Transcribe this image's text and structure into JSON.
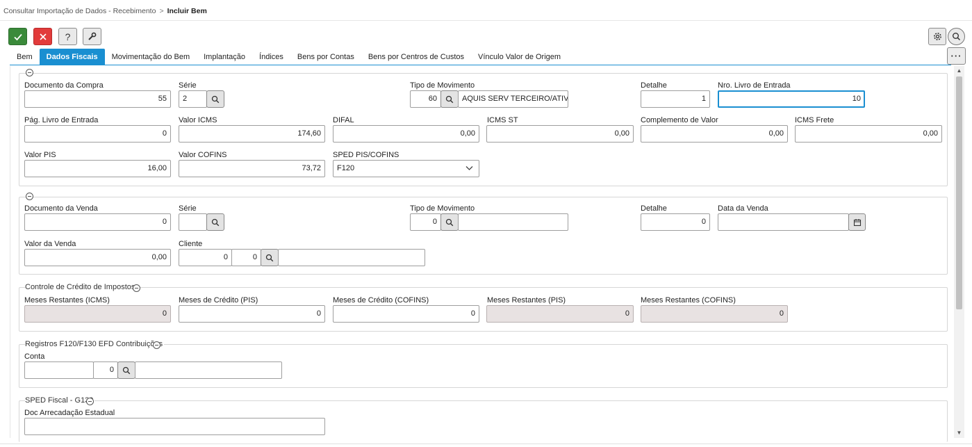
{
  "breadcrumb": {
    "parent": "Consultar Importação de Dados - Recebimento",
    "separator": ">",
    "current": "Incluir Bem"
  },
  "toolbar": {
    "help_label": "?",
    "more_label": "···"
  },
  "tabs": [
    "Bem",
    "Dados Fiscais",
    "Movimentação do Bem",
    "Implantação",
    "Índices",
    "Bens por Contas",
    "Bens por Centros de Custos",
    "Vínculo Valor de Origem"
  ],
  "active_tab": "Dados Fiscais",
  "compra": {
    "documento_label": "Documento da Compra",
    "documento_value": "55",
    "serie_label": "Série",
    "serie_value": "2",
    "tipo_mov_label": "Tipo de Movimento",
    "tipo_mov_code": "60",
    "tipo_mov_desc": "AQUIS SERV TERCEIRO/ATIVO",
    "detalhe_label": "Detalhe",
    "detalhe_value": "1",
    "nro_livro_label": "Nro. Livro de Entrada",
    "nro_livro_value": "10",
    "pag_livro_label": "Pág. Livro de Entrada",
    "pag_livro_value": "0",
    "valor_icms_label": "Valor ICMS",
    "valor_icms_value": "174,60",
    "difal_label": "DIFAL",
    "difal_value": "0,00",
    "icms_st_label": "ICMS ST",
    "icms_st_value": "0,00",
    "complemento_label": "Complemento de Valor",
    "complemento_value": "0,00",
    "icms_frete_label": "ICMS Frete",
    "icms_frete_value": "0,00",
    "valor_pis_label": "Valor PIS",
    "valor_pis_value": "16,00",
    "valor_cofins_label": "Valor COFINS",
    "valor_cofins_value": "73,72",
    "sped_label": "SPED PIS/COFINS",
    "sped_value": "F120"
  },
  "venda": {
    "documento_label": "Documento da Venda",
    "documento_value": "0",
    "serie_label": "Série",
    "serie_value": "",
    "tipo_mov_label": "Tipo de Movimento",
    "tipo_mov_code": "0",
    "tipo_mov_desc": "",
    "detalhe_label": "Detalhe",
    "detalhe_value": "0",
    "data_label": "Data da Venda",
    "data_value": "",
    "valor_label": "Valor da Venda",
    "valor_value": "0,00",
    "cliente_label": "Cliente",
    "cliente_code1": "0",
    "cliente_code2": "0",
    "cliente_desc": ""
  },
  "credito": {
    "title": "Controle de Crédito de Impostos",
    "meses_icms_label": "Meses Restantes (ICMS)",
    "meses_icms_value": "0",
    "credito_pis_label": "Meses de Crédito (PIS)",
    "credito_pis_value": "0",
    "credito_cofins_label": "Meses de Crédito (COFINS)",
    "credito_cofins_value": "0",
    "restantes_pis_label": "Meses Restantes (PIS)",
    "restantes_pis_value": "0",
    "restantes_cofins_label": "Meses Restantes (COFINS)",
    "restantes_cofins_value": "0"
  },
  "registros": {
    "title": "Registros F120/F130 EFD Contribuições",
    "conta_label": "Conta",
    "conta_code": "",
    "conta_num": "0",
    "conta_desc": ""
  },
  "sped_fiscal": {
    "title": "SPED Fiscal - G130",
    "doc_label": "Doc Arrecadação Estadual",
    "doc_value": ""
  },
  "colors": {
    "accent": "#1a8fd1",
    "confirm": "#3a8a3a",
    "cancel": "#e23b3b",
    "readonly_bg": "#e8e2e2"
  }
}
